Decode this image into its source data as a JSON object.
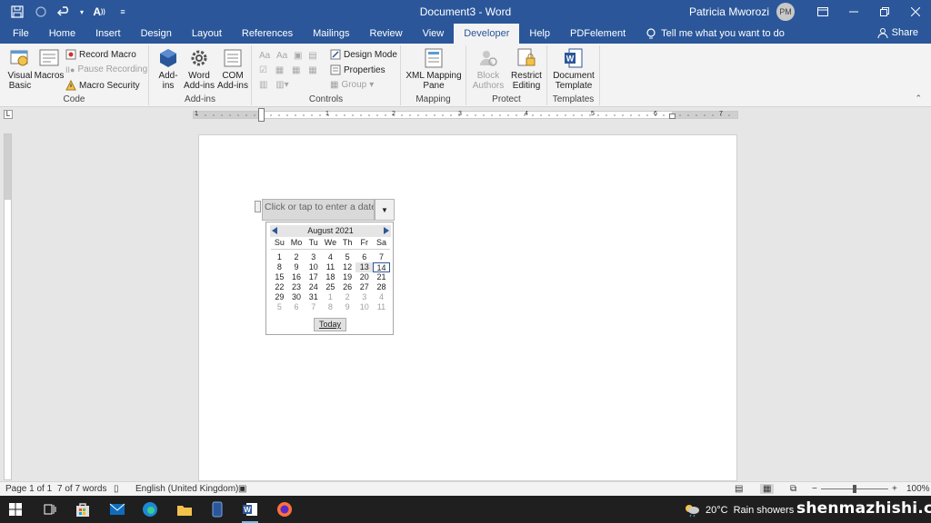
{
  "titlebar": {
    "document_title": "Document3  -  Word",
    "user_name": "Patricia Mworozi",
    "user_initials": "PM"
  },
  "tabs": [
    "File",
    "Home",
    "Insert",
    "Design",
    "Layout",
    "References",
    "Mailings",
    "Review",
    "View",
    "Developer",
    "Help",
    "PDFelement"
  ],
  "active_tab": "Developer",
  "tell_me": "Tell me what you want to do",
  "share": "Share",
  "ribbon": {
    "code": {
      "label": "Code",
      "visual_basic": "Visual\nBasic",
      "macros": "Macros",
      "record_macro": "Record Macro",
      "pause_recording": "Pause Recording",
      "macro_security": "Macro Security"
    },
    "addins": {
      "label": "Add-ins",
      "addins": "Add-\nins",
      "word_addins": "Word\nAdd-ins",
      "com_addins": "COM\nAdd-ins"
    },
    "controls": {
      "label": "Controls",
      "design_mode": "Design Mode",
      "properties": "Properties",
      "group": "Group"
    },
    "mapping": {
      "label": "Mapping",
      "xml_pane": "XML Mapping\nPane"
    },
    "protect": {
      "label": "Protect",
      "block_authors": "Block\nAuthors",
      "restrict_editing": "Restrict\nEditing"
    },
    "templates": {
      "label": "Templates",
      "document_template": "Document\nTemplate"
    }
  },
  "ruler_numbers": [
    "1",
    "1",
    "2",
    "3",
    "4",
    "5",
    "6",
    "7"
  ],
  "date_control": {
    "placeholder": "Click or tap to enter a date.",
    "month_label": "August 2021",
    "weekdays": [
      "Su",
      "Mo",
      "Tu",
      "We",
      "Th",
      "Fr",
      "Sa"
    ],
    "weeks": [
      [
        "1",
        "2",
        "3",
        "4",
        "5",
        "6",
        "7"
      ],
      [
        "8",
        "9",
        "10",
        "11",
        "12",
        "13",
        "14"
      ],
      [
        "15",
        "16",
        "17",
        "18",
        "19",
        "20",
        "21"
      ],
      [
        "22",
        "23",
        "24",
        "25",
        "26",
        "27",
        "28"
      ],
      [
        "29",
        "30",
        "31",
        "1",
        "2",
        "3",
        "4"
      ],
      [
        "5",
        "6",
        "7",
        "8",
        "9",
        "10",
        "11"
      ]
    ],
    "today_button": "Today",
    "selected_day": "14",
    "highlighted_day": "13"
  },
  "statusbar": {
    "page": "Page 1 of 1",
    "words": "7 of 7 words",
    "language": "English (United Kingdom)",
    "zoom_minus": "−",
    "zoom_plus": "+",
    "zoom": "100%"
  },
  "taskbar": {
    "temperature": "20°C",
    "weather": "Rain showers",
    "watermark": "shenmazhishi.com"
  },
  "colors": {
    "word_blue": "#2b579a",
    "ribbon_bg": "#f3f3f3",
    "canvas_bg": "#e6e6e6",
    "taskbar_bg": "#1f1f1f"
  }
}
